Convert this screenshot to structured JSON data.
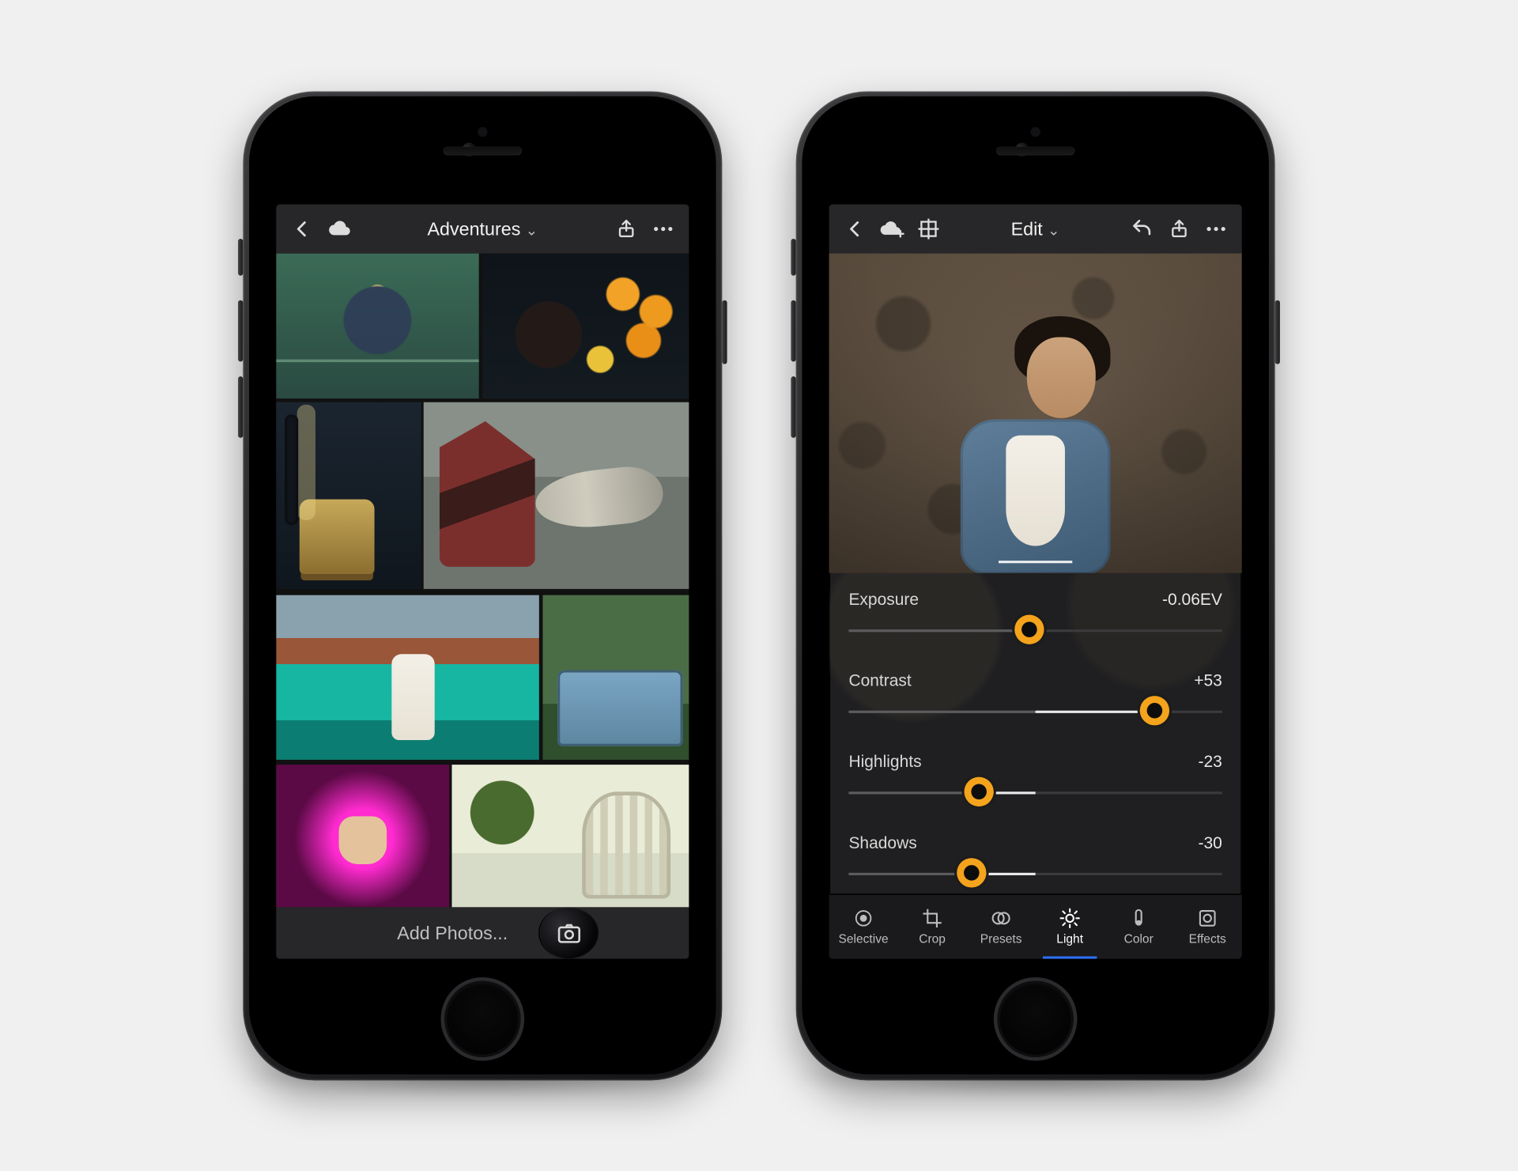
{
  "left": {
    "header": {
      "title": "Adventures"
    },
    "addbar_label": "Add Photos..."
  },
  "right": {
    "header": {
      "title": "Edit"
    },
    "sliders": [
      {
        "label": "Exposure",
        "value_text": "-0.06EV",
        "pos": 48.5
      },
      {
        "label": "Contrast",
        "value_text": "+53",
        "pos": 82
      },
      {
        "label": "Highlights",
        "value_text": "-23",
        "pos": 35
      },
      {
        "label": "Shadows",
        "value_text": "-30",
        "pos": 33
      }
    ],
    "tools": [
      {
        "label": "Selective",
        "active": false
      },
      {
        "label": "Crop",
        "active": false
      },
      {
        "label": "Presets",
        "active": false
      },
      {
        "label": "Light",
        "active": true
      },
      {
        "label": "Color",
        "active": false
      },
      {
        "label": "Effects",
        "active": false
      }
    ]
  }
}
